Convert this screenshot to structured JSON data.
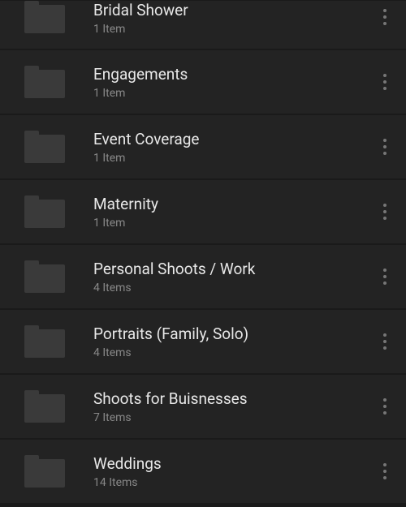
{
  "folders": [
    {
      "title": "Bridal Shower",
      "count": "1 Item"
    },
    {
      "title": "Engagements",
      "count": "1 Item"
    },
    {
      "title": "Event Coverage",
      "count": "1 Item"
    },
    {
      "title": "Maternity",
      "count": "1 Item"
    },
    {
      "title": "Personal Shoots / Work",
      "count": "4 Items"
    },
    {
      "title": "Portraits (Family, Solo)",
      "count": "4 Items"
    },
    {
      "title": "Shoots for Buisnesses",
      "count": "7 Items"
    },
    {
      "title": "Weddings",
      "count": "14 Items"
    }
  ]
}
